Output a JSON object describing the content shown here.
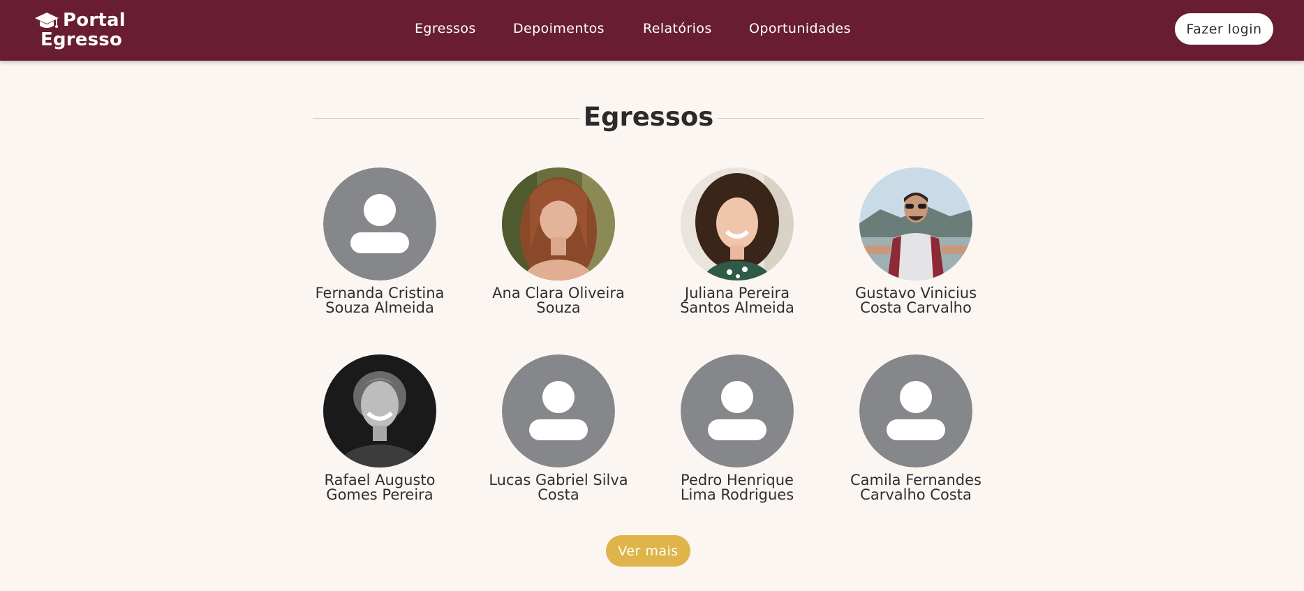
{
  "header": {
    "brand_line1": "Portal",
    "brand_line2": "Egresso",
    "brand_icon": "graduation-cap-icon",
    "nav": [
      "Egressos",
      "Depoimentos",
      "Relatórios",
      "Oportunidades"
    ],
    "login_label": "Fazer login",
    "bar_color": "#691d32"
  },
  "section": {
    "title": "Egressos"
  },
  "alumni": [
    {
      "name_line1": "Fernanda Cristina",
      "name_line2": "Souza Almeida",
      "avatar": "placeholder-avatar-icon"
    },
    {
      "name_line1": "Ana Clara Oliveira",
      "name_line2": "Souza",
      "avatar": "photo-woman-long-red-hair"
    },
    {
      "name_line1": "Juliana Pereira",
      "name_line2": "Santos Almeida",
      "avatar": "photo-woman-curly-hair-smiling"
    },
    {
      "name_line1": "Gustavo Vinicius",
      "name_line2": "Costa Carvalho",
      "avatar": "photo-man-glasses-outdoors"
    },
    {
      "name_line1": "Rafael Augusto",
      "name_line2": "Gomes Pereira",
      "avatar": "photo-man-black-and-white"
    },
    {
      "name_line1": "Lucas Gabriel Silva",
      "name_line2": "Costa",
      "avatar": "placeholder-avatar-icon"
    },
    {
      "name_line1": "Pedro Henrique",
      "name_line2": "Lima Rodrigues",
      "avatar": "placeholder-avatar-icon"
    },
    {
      "name_line1": "Camila Fernandes",
      "name_line2": "Carvalho Costa",
      "avatar": "placeholder-avatar-icon"
    }
  ],
  "more_label": "Ver mais",
  "colors": {
    "accent": "#dfb44a",
    "placeholder_avatar": "#86878b",
    "background": "#fcf6f3"
  }
}
